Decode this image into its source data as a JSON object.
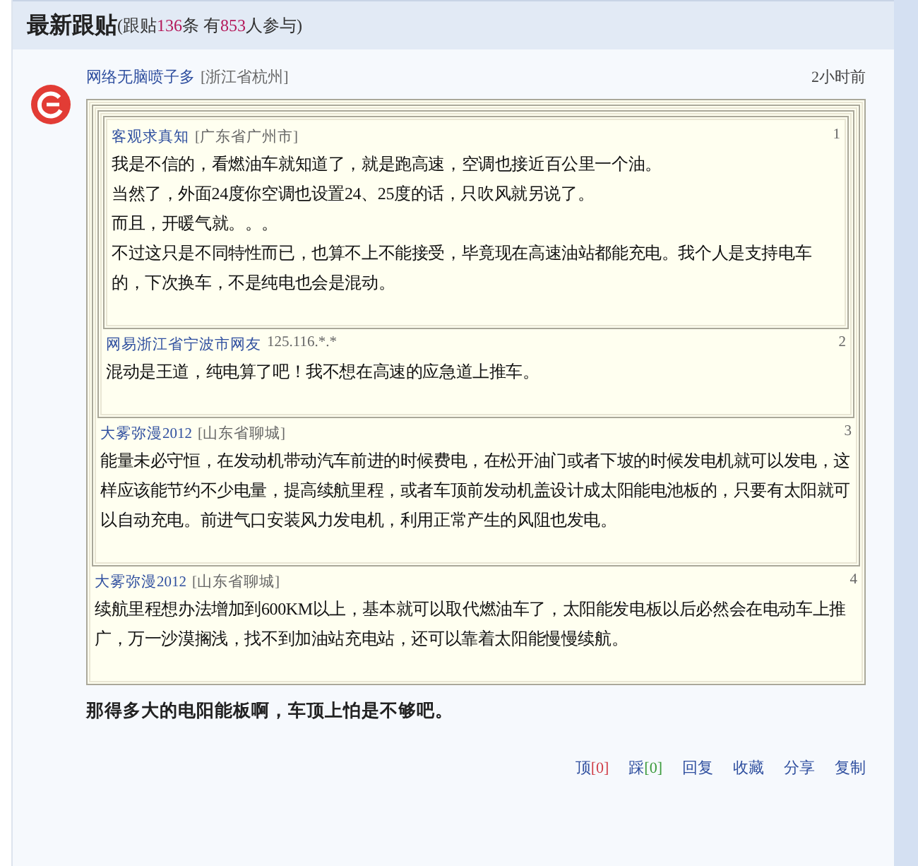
{
  "section": {
    "title": "最新跟贴",
    "summary_prefix": "(跟贴",
    "post_count": "136",
    "summary_middle": "条 有",
    "participant_count": "853",
    "summary_suffix": "人参与)"
  },
  "post": {
    "author": "网络无脑喷子多",
    "location": "[浙江省杭州]",
    "time": "2小时前",
    "quote": {
      "author": "大雾弥漫2012",
      "location": "[山东省聊城]",
      "floor": "4",
      "lines": [
        "续航里程想办法增加到600KM以上，基本就可以取代燃油车了，太阳能发电板以后必然会在电动车上推广，万一沙漠搁浅，找不到加油站充电站，还可以靠着太阳能慢慢续航。"
      ],
      "quote": {
        "author": "大雾弥漫2012",
        "location": "[山东省聊城]",
        "floor": "3",
        "lines": [
          "能量未必守恒，在发动机带动汽车前进的时候费电，在松开油门或者下坡的时候发电机就可以发电，这样应该能节约不少电量，提高续航里程，或者车顶前发动机盖设计成太阳能电池板的，只要有太阳就可以自动充电。前进气口安装风力发电机，利用正常产生的风阻也发电。"
        ],
        "quote": {
          "author": "网易浙江省宁波市网友",
          "location": "125.116.*.*",
          "floor": "2",
          "lines": [
            "混动是王道，纯电算了吧！我不想在高速的应急道上推车。"
          ],
          "quote": {
            "author": "客观求真知",
            "location": "[广东省广州市]",
            "floor": "1",
            "lines": [
              "我是不信的，看燃油车就知道了，就是跑高速，空调也接近百公里一个油。",
              "当然了，外面24度你空调也设置24、25度的话，只吹风就另说了。",
              "而且，开暖气就。。。",
              "不过这只是不同特性而已，也算不上不能接受，毕竟现在高速油站都能充电。我个人是支持电车的，下次换车，不是纯电也会是混动。"
            ]
          }
        }
      }
    },
    "text": "那得多大的电阳能板啊，车顶上怕是不够吧。",
    "actions": [
      {
        "label": "顶",
        "count": "[0]",
        "kind": "up"
      },
      {
        "label": "踩",
        "count": "[0]",
        "kind": "down"
      },
      {
        "label": "回复"
      },
      {
        "label": "收藏"
      },
      {
        "label": "分享"
      },
      {
        "label": "复制"
      }
    ]
  }
}
